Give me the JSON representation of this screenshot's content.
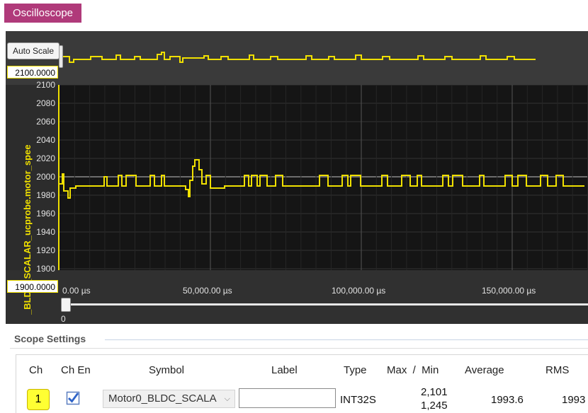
{
  "tab": {
    "label": "Oscilloscope"
  },
  "scope": {
    "auto_scale_label": "Auto Scale",
    "ymax_value": "2100.0000",
    "ymin_value": "1900.0000",
    "y_axis_title": "_BLDC_SCALAR_ucprobe.motor_spee",
    "y_ticks": [
      "2100",
      "2080",
      "2060",
      "2040",
      "2020",
      "2000",
      "1980",
      "1960",
      "1940",
      "1920",
      "1900"
    ],
    "x_ticks": [
      "0.00  µs",
      "50,000.00  µs",
      "100,000.00  µs",
      "150,000.00  µs"
    ],
    "slider_value": "0",
    "trace_color": "#f0e000"
  },
  "settings": {
    "title": "Scope Settings",
    "headers": {
      "ch": "Ch",
      "ch_en": "Ch En",
      "symbol": "Symbol",
      "label": "Label",
      "type": "Type",
      "maxmin": "Max  /  Min",
      "average": "Average",
      "rms": "RMS"
    },
    "row": {
      "ch": "1",
      "ch_en": true,
      "symbol": "Motor0_BLDC_SCALA",
      "label": "",
      "type": "INT32S",
      "max": "2,101",
      "min": "1,245",
      "average": "1993.6",
      "rms": "1993"
    }
  }
}
